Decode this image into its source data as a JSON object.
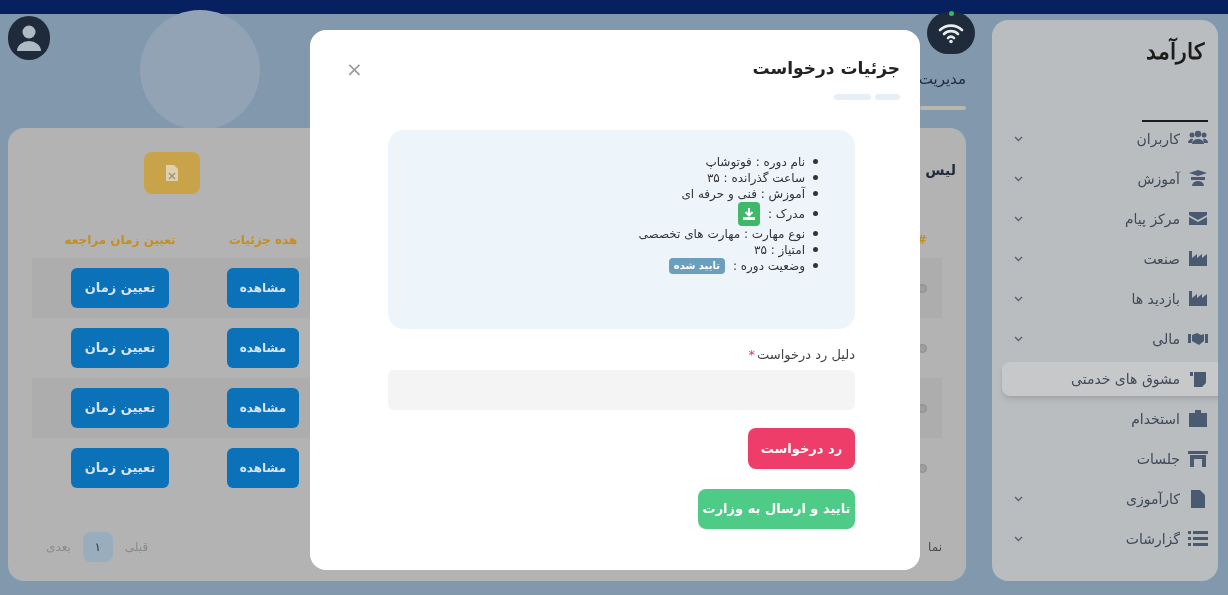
{
  "sidebar": {
    "logo": "کارآمد",
    "items": [
      {
        "label": "کاربران",
        "expandable": true,
        "selected": false
      },
      {
        "label": "آموزش",
        "expandable": true,
        "selected": false
      },
      {
        "label": "مرکز پیام",
        "expandable": true,
        "selected": false
      },
      {
        "label": "صنعت",
        "expandable": true,
        "selected": false
      },
      {
        "label": "بازدید ها",
        "expandable": true,
        "selected": false
      },
      {
        "label": "مالی",
        "expandable": true,
        "selected": false
      },
      {
        "label": "مشوق های خدمتی",
        "expandable": false,
        "selected": true
      },
      {
        "label": "استخدام",
        "expandable": false,
        "selected": false
      },
      {
        "label": "جلسات",
        "expandable": false,
        "selected": false
      },
      {
        "label": "کارآموزی",
        "expandable": true,
        "selected": false
      },
      {
        "label": "گزارشات",
        "expandable": true,
        "selected": false
      }
    ]
  },
  "header": {
    "title": "مدیریت"
  },
  "card": {
    "title": "لیس",
    "columns": [
      "#",
      "هده جزئیات",
      "تعیین زمان مراجعه"
    ],
    "rows": [
      {
        "details": "مشاهده",
        "schedule": "تعیین زمان"
      },
      {
        "details": "مشاهده",
        "schedule": "تعیین زمان"
      },
      {
        "details": "مشاهده",
        "schedule": "تعیین زمان"
      },
      {
        "details": "مشاهده",
        "schedule": "تعیین زمان"
      }
    ],
    "footer_text": "نما",
    "pagination": {
      "previous": "قبلی",
      "next": "بعدی",
      "pages": [
        {
          "label": "۱",
          "selected": true
        }
      ]
    }
  },
  "modal": {
    "title": "جزئیات درخواست",
    "close": "×",
    "details": [
      {
        "kind": "text",
        "text": "نام دوره : فوتوشاپ"
      },
      {
        "kind": "text",
        "text": "ساعت گذرانده : ۳۵"
      },
      {
        "kind": "text",
        "text": "آموزش : فنی و حرفه ای"
      },
      {
        "kind": "download",
        "text": "مدرک :"
      },
      {
        "kind": "text",
        "text": "نوع مهارت : مهارت های تخصصی"
      },
      {
        "kind": "text",
        "text": "امتیاز : ۳۵"
      },
      {
        "kind": "badge",
        "text": "وضعیت دوره :",
        "badge": "تایید شده"
      }
    ],
    "reason_field": {
      "label": "دلیل رد درخواست",
      "required_mark": "*"
    },
    "reject_button": "رد درخواست",
    "approve_button": "تایید و ارسال به وزارت"
  }
}
